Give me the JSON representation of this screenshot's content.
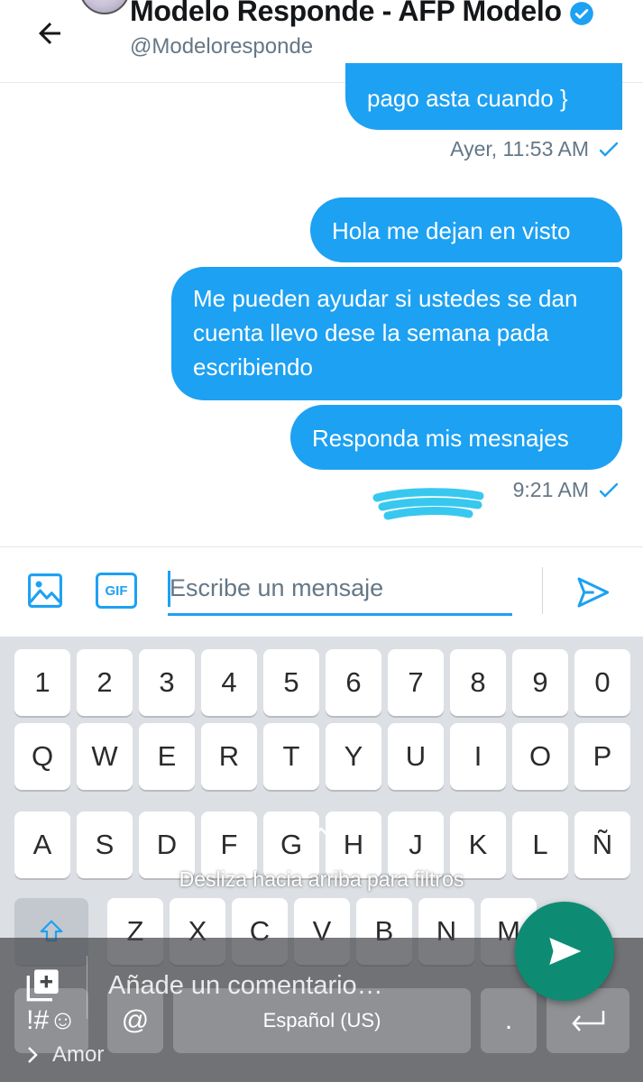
{
  "header": {
    "title": "Modelo Responde - AFP Modelo",
    "handle": "@Modeloresponde"
  },
  "messages": [
    {
      "text": "pago  asta cuando }"
    },
    {
      "text": "Hola me dejan en visto"
    },
    {
      "text": "Me pueden ayudar si ustedes se dan cuenta llevo dese la semana pada escribiendo"
    },
    {
      "text": "Responda mis mesnajes"
    }
  ],
  "timestamps": [
    "Ayer, 11:53 AM",
    "9:21 AM"
  ],
  "compose": {
    "placeholder": "Escribe un mensaje",
    "gif_label": "GIF"
  },
  "keyboard": {
    "numbers": [
      "1",
      "2",
      "3",
      "4",
      "5",
      "6",
      "7",
      "8",
      "9",
      "0"
    ],
    "row1": [
      "Q",
      "W",
      "E",
      "R",
      "T",
      "Y",
      "U",
      "I",
      "O",
      "P"
    ],
    "row2": [
      "A",
      "S",
      "D",
      "F",
      "G",
      "H",
      "J",
      "K",
      "L",
      "Ñ"
    ],
    "row3": [
      "Z",
      "X",
      "C",
      "V",
      "B",
      "N",
      "M"
    ],
    "symbols_key": "!#☺",
    "at_key": "@",
    "space_label": "Español (US)",
    "period_key": ".",
    "filter_hint": "Desliza hacia arriba para filtros"
  },
  "overlay": {
    "comment_placeholder": "Añade un comentario…",
    "caption": "Amor"
  },
  "colors": {
    "twitter_blue": "#1da1f2",
    "whatsapp_green": "#0e8c73",
    "keyboard_bg": "#dcdfe3"
  }
}
